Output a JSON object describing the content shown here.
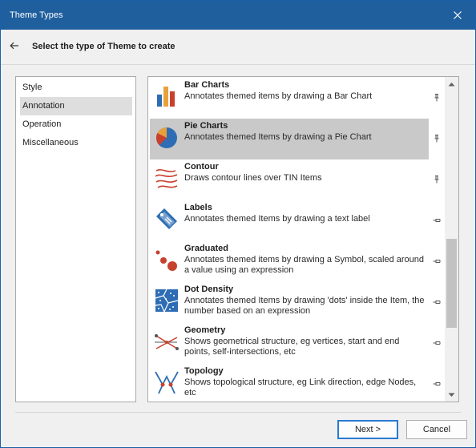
{
  "window": {
    "title": "Theme Types"
  },
  "header": {
    "heading": "Select the type of Theme to create"
  },
  "categories": [
    {
      "label": "Style",
      "selected": false
    },
    {
      "label": "Annotation",
      "selected": true
    },
    {
      "label": "Operation",
      "selected": false
    },
    {
      "label": "Miscellaneous",
      "selected": false
    }
  ],
  "themes": [
    {
      "name": "Bar Charts",
      "description": "Annotates themed items by drawing a Bar Chart",
      "icon": "bar-chart-icon",
      "pinned": true,
      "selected": false
    },
    {
      "name": "Pie Charts",
      "description": "Annotates themed Items by drawing a Pie Chart",
      "icon": "pie-chart-icon",
      "pinned": true,
      "selected": true
    },
    {
      "name": "Contour",
      "description": "Draws contour lines over TIN Items",
      "icon": "contour-icon",
      "pinned": true,
      "selected": false
    },
    {
      "name": "Labels",
      "description": "Annotates themed Items by drawing a text label",
      "icon": "label-tag-icon",
      "pinned": false,
      "selected": false
    },
    {
      "name": "Graduated",
      "description": "Annotates themed items by drawing a Symbol, scaled around a value using an expression",
      "icon": "graduated-symbols-icon",
      "pinned": false,
      "selected": false
    },
    {
      "name": "Dot Density",
      "description": "Annotates themed Items by drawing 'dots' inside the Item, the number based on an expression",
      "icon": "dot-density-icon",
      "pinned": false,
      "selected": false
    },
    {
      "name": "Geometry",
      "description": "Shows geometrical structure, eg vertices, start and end points, self-intersections, etc",
      "icon": "geometry-icon",
      "pinned": false,
      "selected": false
    },
    {
      "name": "Topology",
      "description": "Shows topological structure, eg Link direction, edge Nodes, etc",
      "icon": "topology-icon",
      "pinned": false,
      "selected": false
    }
  ],
  "scrollbar": {
    "position_fraction": 0.71,
    "visible_fraction": 0.71
  },
  "buttons": {
    "next": "Next >",
    "cancel": "Cancel"
  },
  "colors": {
    "titlebar": "#1f5f9e",
    "selection": "#c9c9c9",
    "accent": "#2a7ad2"
  }
}
